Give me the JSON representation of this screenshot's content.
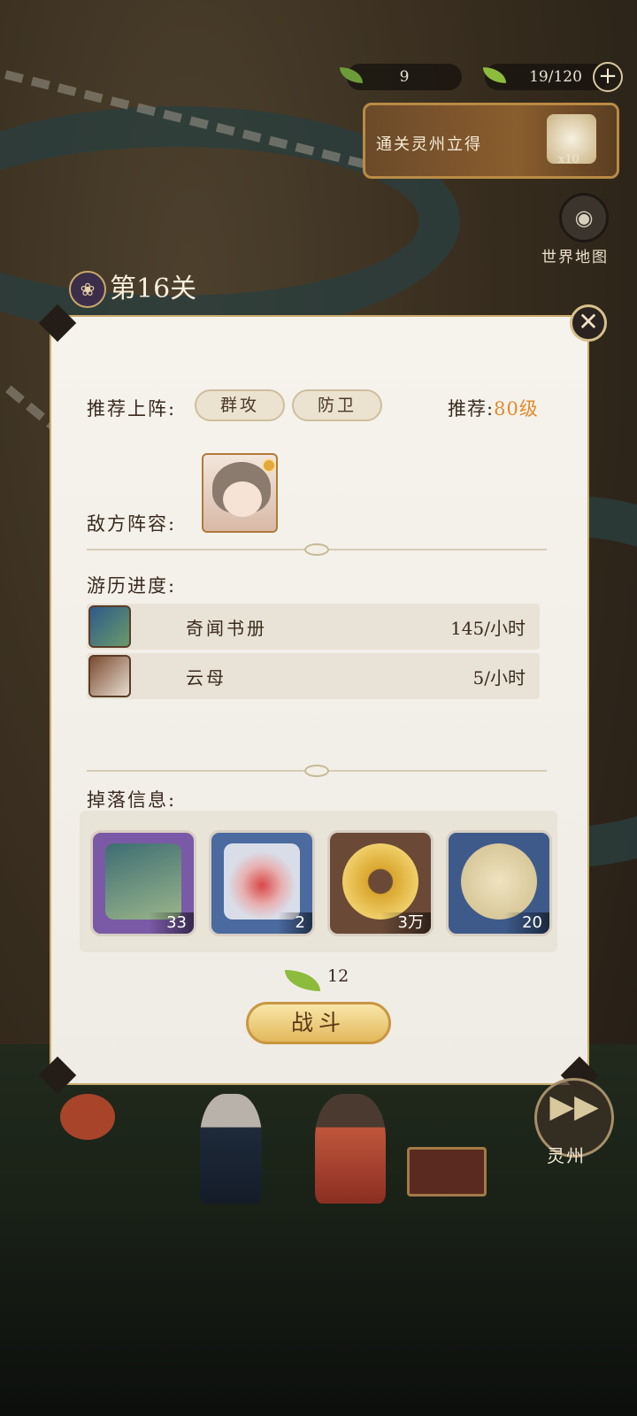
{
  "hud": {
    "stamina_value": "9",
    "leaf_value": "19/120",
    "plus_label": "+",
    "banner_text": "通关灵州立得",
    "banner_reward_count": "x10",
    "world_map_label": "世界地图",
    "world_map_icon": "compass-icon"
  },
  "level": {
    "title": "第16关",
    "badge_icon": "butterfly-emblem-icon"
  },
  "panel": {
    "close_icon": "close-icon",
    "recommend_label": "推荐上阵:",
    "tags": [
      "群攻",
      "防卫"
    ],
    "recommend_level_prefix": "推荐:",
    "recommend_level_value": "80级",
    "enemy_label": "敌方阵容:",
    "progress_label": "游历进度:",
    "progress_rows": [
      {
        "name": "奇闻书册",
        "rate": "145/小时",
        "icon": "book-icon",
        "color": "#2e5a8a"
      },
      {
        "name": "云母",
        "rate": "5/小时",
        "icon": "mica-icon",
        "color": "#7a4a30"
      }
    ],
    "drops_label": "掉落信息:",
    "drops": [
      {
        "count": "33",
        "icon": "book-item-icon",
        "frame": "#7a5aa6",
        "art": "#3d6d73"
      },
      {
        "count": "2",
        "icon": "red-powder-bowl-icon",
        "frame": "#4a6aa0",
        "art": "#d9dde8"
      },
      {
        "count": "3万",
        "icon": "gold-coin-icon",
        "frame": "#6a4a36",
        "art": "#d9a72e"
      },
      {
        "count": "20",
        "icon": "round-fan-icon",
        "frame": "#3d5a8a",
        "art": "#efe3c0"
      }
    ],
    "cost_value": "12",
    "cost_icon": "leaf-icon",
    "fight_label": "战斗"
  },
  "scene": {
    "fast_forward_icon": "fast-forward-icon",
    "fast_forward_label": "灵州"
  }
}
